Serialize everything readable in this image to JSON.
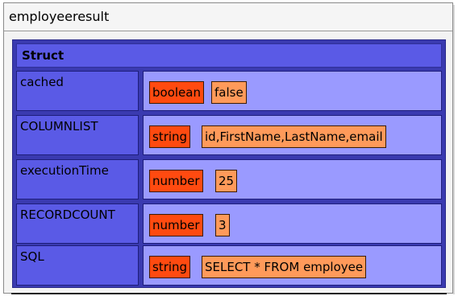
{
  "window": {
    "title": "employeeresult"
  },
  "dump": {
    "header": "Struct",
    "rows": [
      {
        "key": "cached",
        "type": "boolean",
        "value": "false"
      },
      {
        "key": "COLUMNLIST",
        "type": "string",
        "value": "id,FirstName,LastName,email"
      },
      {
        "key": "executionTime",
        "type": "number",
        "value": "25"
      },
      {
        "key": "RECORDCOUNT",
        "type": "number",
        "value": "3"
      },
      {
        "key": "SQL",
        "type": "string",
        "value": "SELECT * FROM employee"
      }
    ]
  },
  "colors": {
    "struct_header": "#5a5ae6",
    "value_cell": "#9a9aff",
    "type_box": "#ff4a10",
    "value_box": "#ff9a5a"
  }
}
